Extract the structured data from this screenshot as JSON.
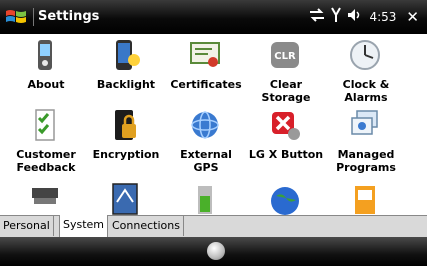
{
  "window": {
    "title": "Settings",
    "time": "4:53"
  },
  "status_icons": [
    "connectivity-icon",
    "signal-icon",
    "speaker-icon"
  ],
  "items": [
    {
      "label": "About",
      "icon": "about-icon"
    },
    {
      "label": "Backlight",
      "icon": "backlight-icon"
    },
    {
      "label": "Certificates",
      "icon": "certificates-icon"
    },
    {
      "label": "Clear Storage",
      "icon": "clear-storage-icon",
      "badge": "CLR"
    },
    {
      "label": "Clock & Alarms",
      "icon": "clock-icon"
    },
    {
      "label": "Customer Feedback",
      "icon": "customer-feedback-icon"
    },
    {
      "label": "Encryption",
      "icon": "encryption-icon"
    },
    {
      "label": "External GPS",
      "icon": "gps-icon"
    },
    {
      "label": "LG X Button",
      "icon": "lg-x-button-icon"
    },
    {
      "label": "Managed Programs",
      "icon": "managed-programs-icon"
    },
    {
      "label": "",
      "icon": "memory-icon"
    },
    {
      "label": "",
      "icon": "screen-icon"
    },
    {
      "label": "",
      "icon": "power-icon"
    },
    {
      "label": "",
      "icon": "globe-icon"
    },
    {
      "label": "",
      "icon": "regional-icon"
    }
  ],
  "tabs": [
    {
      "label": "Personal",
      "active": false
    },
    {
      "label": "System",
      "active": true
    },
    {
      "label": "Connections",
      "active": false
    }
  ]
}
